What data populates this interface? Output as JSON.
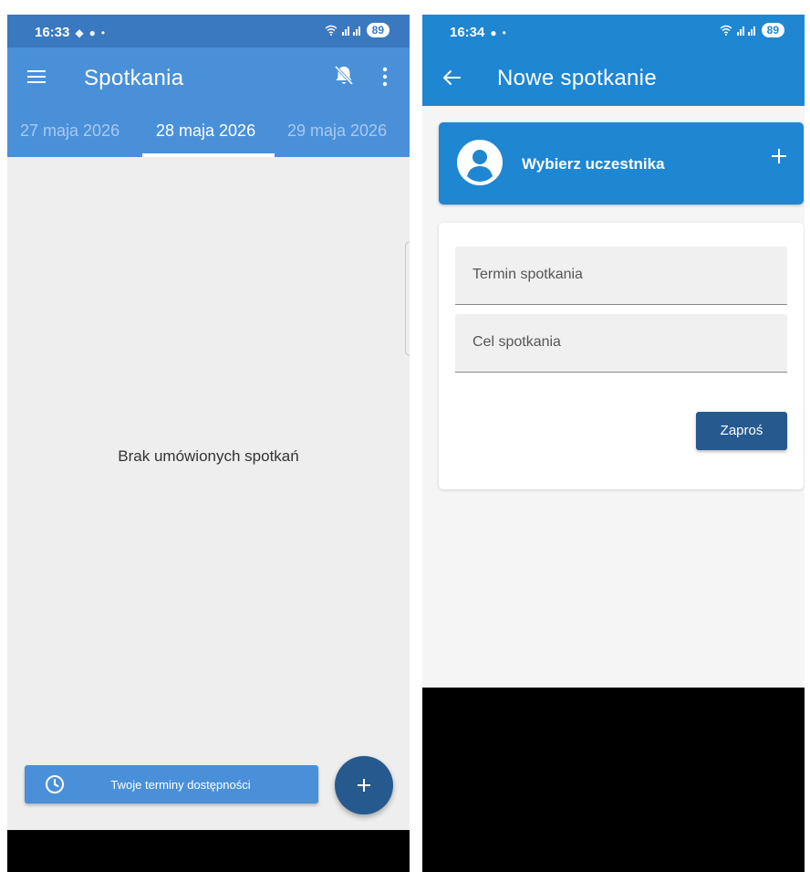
{
  "left_screen": {
    "status": {
      "time": "16:33",
      "battery": "89"
    },
    "appbar": {
      "title": "Spotkania"
    },
    "tabs": [
      {
        "label": "27 maja 2026",
        "active": false
      },
      {
        "label": "28 maja 2026",
        "active": true
      },
      {
        "label": "29 maja 2026",
        "active": false
      }
    ],
    "empty_message": "Brak umówionych spotkań",
    "availability_button": "Twoje terminy dostępności",
    "colors": {
      "primary": "#4a90d9",
      "status": "#3a78c0",
      "accent": "#265a8e",
      "background": "#eeeeee"
    }
  },
  "right_screen": {
    "status": {
      "time": "16:34",
      "battery": "89"
    },
    "appbar": {
      "title": "Nowe spotkanie"
    },
    "participant": {
      "label": "Wybierz uczestnika"
    },
    "form": {
      "term_placeholder": "Termin spotkania",
      "purpose_placeholder": "Cel spotkania",
      "submit": "Zaproś"
    },
    "colors": {
      "primary": "#1f86d2",
      "accent": "#265a8e",
      "background": "#f5f5f5"
    }
  },
  "icons": [
    "menu-icon",
    "bell-off-icon",
    "more-vert-icon",
    "clock-icon",
    "plus-icon",
    "back-arrow-icon",
    "account-circle-icon",
    "wifi-icon",
    "signal-icon",
    "battery-icon"
  ]
}
